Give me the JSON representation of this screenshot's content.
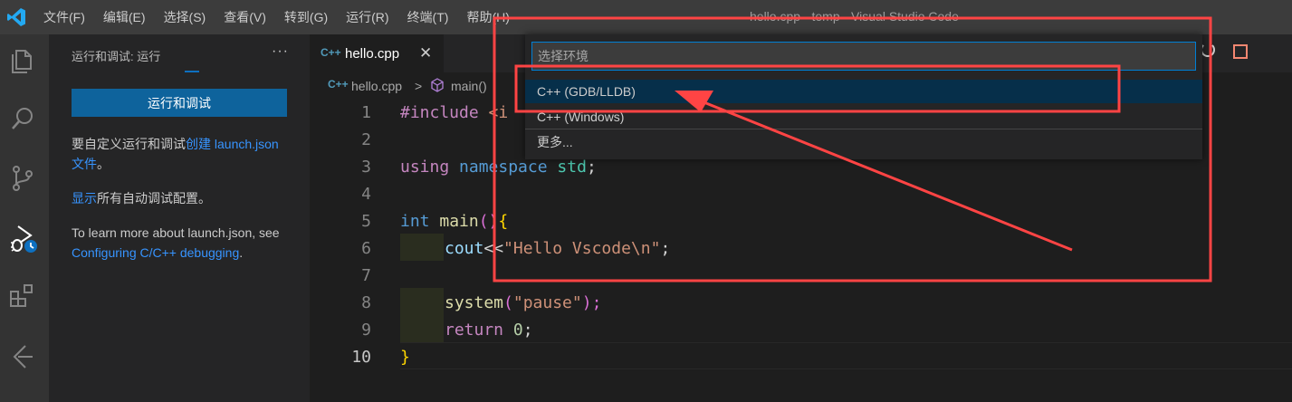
{
  "menus": [
    "文件(F)",
    "编辑(E)",
    "选择(S)",
    "查看(V)",
    "转到(G)",
    "运行(R)",
    "终端(T)",
    "帮助(H)"
  ],
  "window_title": "hello.cpp - temp - Visual Studio Code",
  "sidebar": {
    "title": "运行和调试: 运行",
    "more": "···",
    "run_button": "运行和调试",
    "p1_text": "要自定义运行和调试",
    "p1_link": "创建 launch.json 文件",
    "p1_end": "。",
    "p2_link": "显示",
    "p2_text": "所有自动调试配置。",
    "p3_text": "To learn more about launch.json, see ",
    "p3_link": "Configuring C/C++ debugging",
    "p3_end": "."
  },
  "tab": {
    "icon": "C++",
    "label": "hello.cpp",
    "close": "✕"
  },
  "breadcrumb": {
    "icon": "C++",
    "file": "hello.cpp",
    "sep": ">",
    "symbol": "main()"
  },
  "line_numbers": [
    "1",
    "2",
    "3",
    "4",
    "5",
    "6",
    "7",
    "8",
    "9",
    "10"
  ],
  "code": {
    "l1_kw": "#include",
    "l1_rest": " <i",
    "l3_a": "using",
    "l3_b": "namespace",
    "l3_c": "std",
    "l3_d": ";",
    "l5_a": "int",
    "l5_b": "main",
    "l5_c": "()",
    "l5_d": "{",
    "l6_a": "cout",
    "l6_b": "<<",
    "l6_c": "\"Hello Vscode\\n\"",
    "l6_d": ";",
    "l8_a": "system",
    "l8_b": "(",
    "l8_c": "\"pause\"",
    "l8_d": ");",
    "l9_a": "return",
    "l9_b": "0",
    "l9_c": ";",
    "l10": "}"
  },
  "quick_pick": {
    "placeholder": "选择环境",
    "items": [
      "C++ (GDB/LLDB)",
      "C++ (Windows)",
      "更多..."
    ]
  },
  "colors": {
    "annotation": "#ff4444",
    "accent": "#007fd4",
    "button": "#0e639c"
  }
}
